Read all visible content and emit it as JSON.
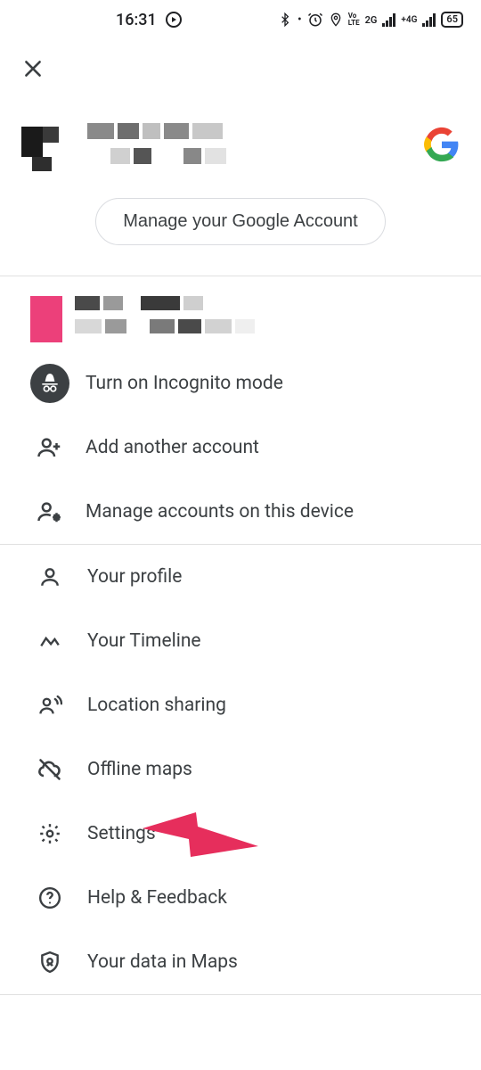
{
  "statusbar": {
    "time": "16:31",
    "battery": "65"
  },
  "manage_button": "Manage your Google Account",
  "menu": {
    "incognito": "Turn on Incognito mode",
    "add_account": "Add another account",
    "manage_accounts": "Manage accounts on this device",
    "profile": "Your profile",
    "timeline": "Your Timeline",
    "location_sharing": "Location sharing",
    "offline_maps": "Offline maps",
    "settings": "Settings",
    "help": "Help & Feedback",
    "your_data": "Your data in Maps"
  }
}
